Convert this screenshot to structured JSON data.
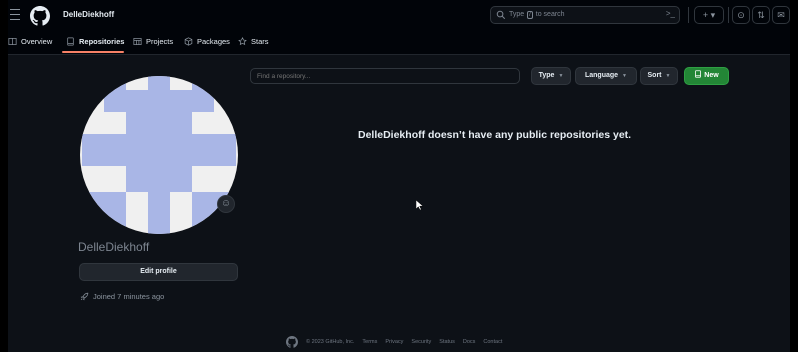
{
  "header": {
    "username": "DelleDiekhoff",
    "search_prefix": "Type",
    "search_key": "/",
    "search_suffix": "to search",
    "command_icon": ">_",
    "plus_label": "+ ▾",
    "issues_icon": "⊙",
    "pulls_icon": "⇅",
    "inbox_icon": "✉"
  },
  "tabs": [
    {
      "label": "Overview",
      "icon": "book-icon"
    },
    {
      "label": "Repositories",
      "icon": "repo-icon",
      "active": true
    },
    {
      "label": "Projects",
      "icon": "table-icon"
    },
    {
      "label": "Packages",
      "icon": "package-icon"
    },
    {
      "label": "Stars",
      "icon": "star-icon"
    }
  ],
  "profile": {
    "name": "DelleDiekhoff",
    "edit_label": "Edit profile",
    "joined": "Joined 7 minutes ago",
    "emoji_icon": "☺"
  },
  "repos": {
    "find_placeholder": "Find a repository...",
    "type_label": "Type",
    "language_label": "Language",
    "sort_label": "Sort",
    "new_label": "New",
    "empty_message": "DelleDiekhoff doesn’t have any public repositories yet."
  },
  "footer": {
    "copyright": "© 2023 GitHub, Inc.",
    "links": [
      "Terms",
      "Privacy",
      "Security",
      "Status",
      "Docs",
      "Contact"
    ]
  },
  "colors": {
    "accent_underline": "#f78166",
    "new_button": "#238636",
    "avatar_pattern": "#a9b6e6"
  }
}
